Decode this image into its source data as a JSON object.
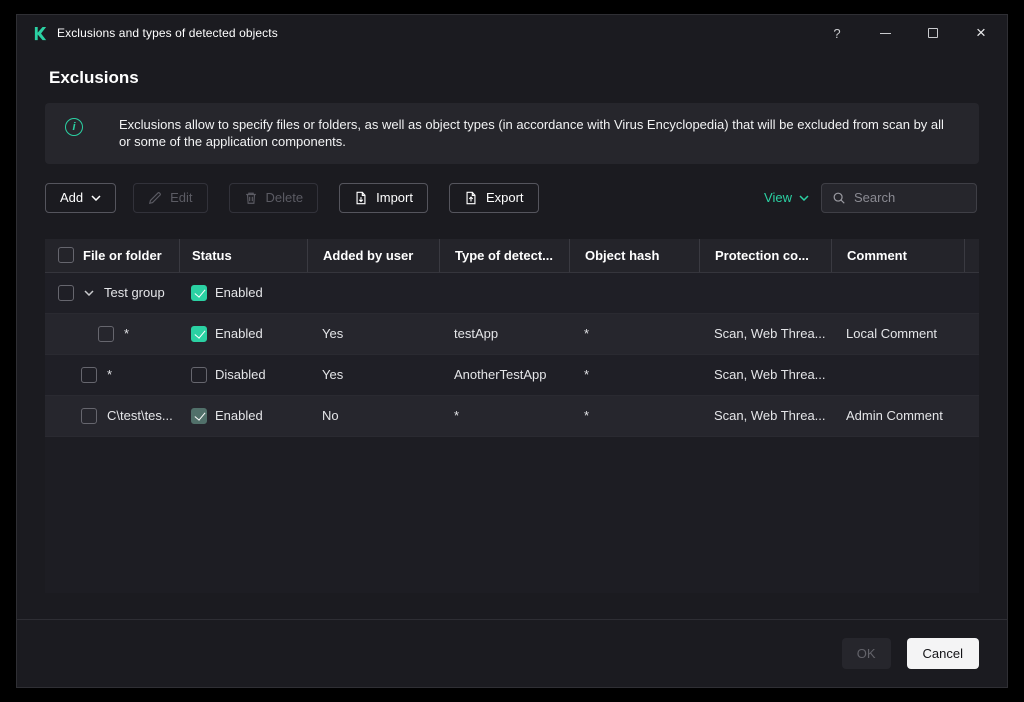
{
  "window": {
    "title": "Exclusions and types of detected objects",
    "controls": {
      "help": "?",
      "close": "×"
    }
  },
  "page": {
    "title": "Exclusions",
    "info_text": "Exclusions allow to specify files or folders, as well as object types (in accordance with Virus Encyclopedia) that will be excluded from scan by all or some of the application components."
  },
  "toolbar": {
    "add": "Add",
    "edit": "Edit",
    "delete": "Delete",
    "import": "Import",
    "export": "Export",
    "view": "View",
    "search_placeholder": "Search"
  },
  "table": {
    "columns": [
      "File or folder",
      "Status",
      "Added by user",
      "Type of detect...",
      "Object hash",
      "Protection co...",
      "Comment"
    ],
    "group": {
      "name": "Test group",
      "status": "Enabled",
      "checked": true
    },
    "rows": [
      {
        "file": "*",
        "status": "Enabled",
        "checked": true,
        "muted": false,
        "added": "Yes",
        "type": "testApp",
        "hash": "*",
        "protection": "Scan, Web Threa...",
        "comment": "Local Comment"
      },
      {
        "file": "*",
        "status": "Disabled",
        "checked": false,
        "muted": false,
        "added": "Yes",
        "type": "AnotherTestApp",
        "hash": "*",
        "protection": "Scan, Web Threa...",
        "comment": ""
      },
      {
        "file": "C\\test\\tes...",
        "status": "Enabled",
        "checked": true,
        "muted": true,
        "added": "No",
        "type": "*",
        "hash": "*",
        "protection": "Scan, Web Threa...",
        "comment": "Admin Comment"
      }
    ]
  },
  "footer": {
    "ok": "OK",
    "cancel": "Cancel"
  },
  "colors": {
    "accent": "#2bd1a3"
  }
}
